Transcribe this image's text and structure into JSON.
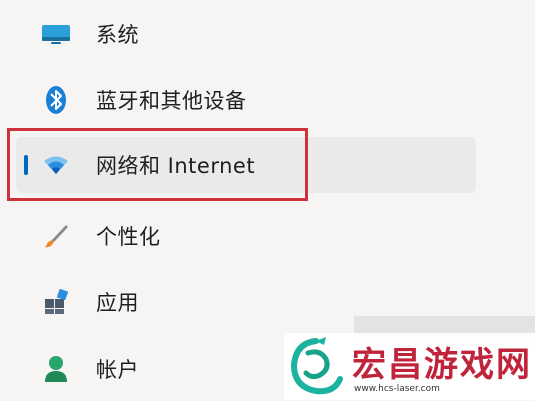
{
  "nav": {
    "items": [
      {
        "label": "系统",
        "icon": "display-icon",
        "selected": false
      },
      {
        "label": "蓝牙和其他设备",
        "icon": "bluetooth-icon",
        "selected": false
      },
      {
        "label": "网络和 Internet",
        "icon": "wifi-icon",
        "selected": true
      },
      {
        "label": "个性化",
        "icon": "brush-icon",
        "selected": false
      },
      {
        "label": "应用",
        "icon": "apps-icon",
        "selected": false
      },
      {
        "label": "帐户",
        "icon": "person-icon",
        "selected": false
      }
    ]
  },
  "watermark": {
    "brand": "宏昌游戏网",
    "url": "www.hcs-laser.com"
  },
  "colors": {
    "accent": "#0067c0",
    "highlight": "#d0323c",
    "watermark": "#c0243b"
  }
}
